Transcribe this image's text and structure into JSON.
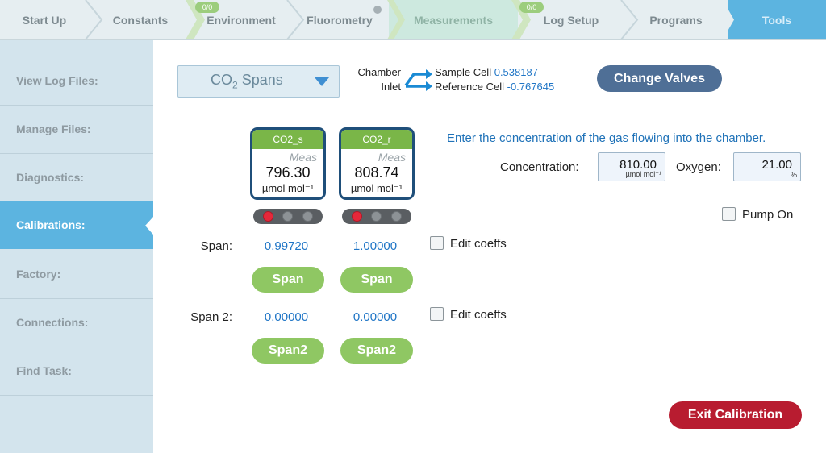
{
  "tabs": [
    {
      "label": "Start Up"
    },
    {
      "label": "Constants"
    },
    {
      "label": "Environment",
      "badge": "0/0"
    },
    {
      "label": "Fluorometry"
    },
    {
      "label": "Measurements"
    },
    {
      "label": "Log Setup",
      "badge": "0/0"
    },
    {
      "label": "Programs"
    },
    {
      "label": "Tools"
    }
  ],
  "sidebar": {
    "items": [
      {
        "label": "View Log Files:"
      },
      {
        "label": "Manage Files:"
      },
      {
        "label": "Diagnostics:"
      },
      {
        "label": "Calibrations:"
      },
      {
        "label": "Factory:"
      },
      {
        "label": "Connections:"
      },
      {
        "label": "Find Task:"
      }
    ]
  },
  "mode_select": {
    "label": "CO",
    "sub": "2",
    "label_after": " Spans"
  },
  "valves": {
    "chamber_label": "Chamber",
    "inlet_label": "Inlet",
    "sample_label": "Sample Cell",
    "sample_value": "0.538187",
    "reference_label": "Reference Cell",
    "reference_value": "-0.767645"
  },
  "change_valves_label": "Change Valves",
  "instruction": "Enter the concentration of the gas flowing into the chamber.",
  "concentration": {
    "label": "Concentration:",
    "value": "810.00",
    "unit": "µmol mol⁻¹"
  },
  "oxygen": {
    "label": "Oxygen:",
    "value": "21.00",
    "unit": "%"
  },
  "pump": {
    "label": "Pump On"
  },
  "gauges": [
    {
      "title": "CO2_s",
      "status": "Meas",
      "value": "796.30",
      "unit": "µmol mol⁻¹"
    },
    {
      "title": "CO2_r",
      "status": "Meas",
      "value": "808.74",
      "unit": "µmol mol⁻¹"
    }
  ],
  "span": {
    "label": "Span:",
    "values": [
      "0.99720",
      "1.00000"
    ],
    "button": "Span",
    "edit_label": "Edit coeffs"
  },
  "span2": {
    "label": "Span 2:",
    "values": [
      "0.00000",
      "0.00000"
    ],
    "button": "Span2",
    "edit_label": "Edit coeffs"
  },
  "exit_label": "Exit Calibration",
  "colors": {
    "accent": "#5cb4e0",
    "exit": "#b81c30",
    "green": "#8fc763",
    "valve_button": "#4f6f96",
    "value_text": "#1f75c6"
  }
}
